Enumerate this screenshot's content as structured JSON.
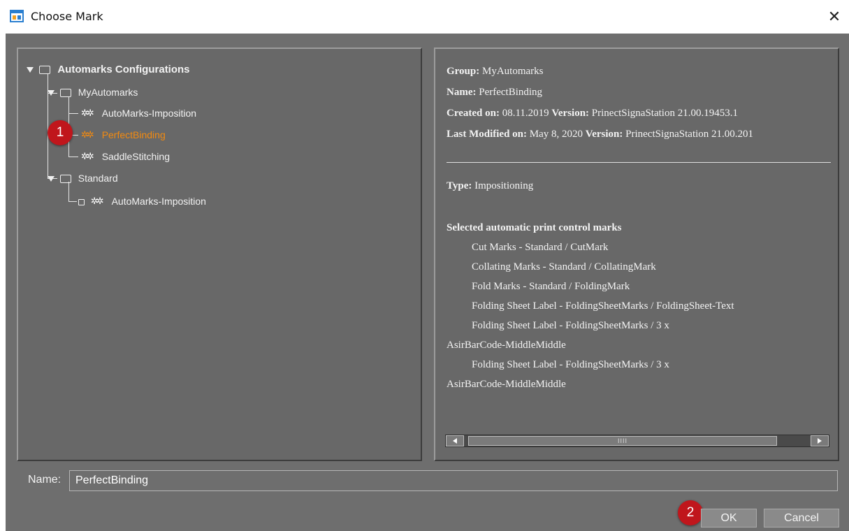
{
  "window": {
    "title": "Choose Mark",
    "close_symbol": "✕"
  },
  "tree": {
    "root": "Automarks Configurations",
    "group1": "MyAutomarks",
    "group1_items": [
      "AutoMarks-Imposition",
      "PerfectBinding",
      "SaddleStitching"
    ],
    "group2": "Standard",
    "group2_items": [
      "AutoMarks-Imposition"
    ],
    "selected": "PerfectBinding"
  },
  "badges": {
    "one": "1",
    "two": "2"
  },
  "info": {
    "group_label": "Group:",
    "group_value": "MyAutomarks",
    "name_label": "Name:",
    "name_value": "PerfectBinding",
    "created_label": "Created on:",
    "created_value": "08.11.2019",
    "version_label": "Version:",
    "created_version": "PrinectSignaStation 21.00.19453.1",
    "modified_label": "Last Modified on:",
    "modified_value": "May 8, 2020",
    "modified_version": "PrinectSignaStation 21.00.201",
    "type_label": "Type:",
    "type_value": "Impositioning",
    "marks_heading": "Selected automatic print control marks",
    "marks": [
      "Cut Marks - Standard / CutMark",
      "Collating Marks - Standard / CollatingMark",
      "Fold Marks - Standard / FoldingMark",
      "Folding Sheet Label - FoldingSheetMarks / FoldingSheet-Text",
      "Folding Sheet Label - FoldingSheetMarks / 3 x",
      "AsirBarCode-MiddleMiddle",
      "Folding Sheet Label - FoldingSheetMarks / 3 x",
      "AsirBarCode-MiddleMiddle"
    ],
    "scroll_thumb": "IIII"
  },
  "name_field": {
    "label": "Name:",
    "value": "PerfectBinding"
  },
  "buttons": {
    "ok": "OK",
    "cancel": "Cancel"
  },
  "colors": {
    "background": "#6e6e6e",
    "selected": "#f28a10",
    "badge": "#c0161c"
  }
}
